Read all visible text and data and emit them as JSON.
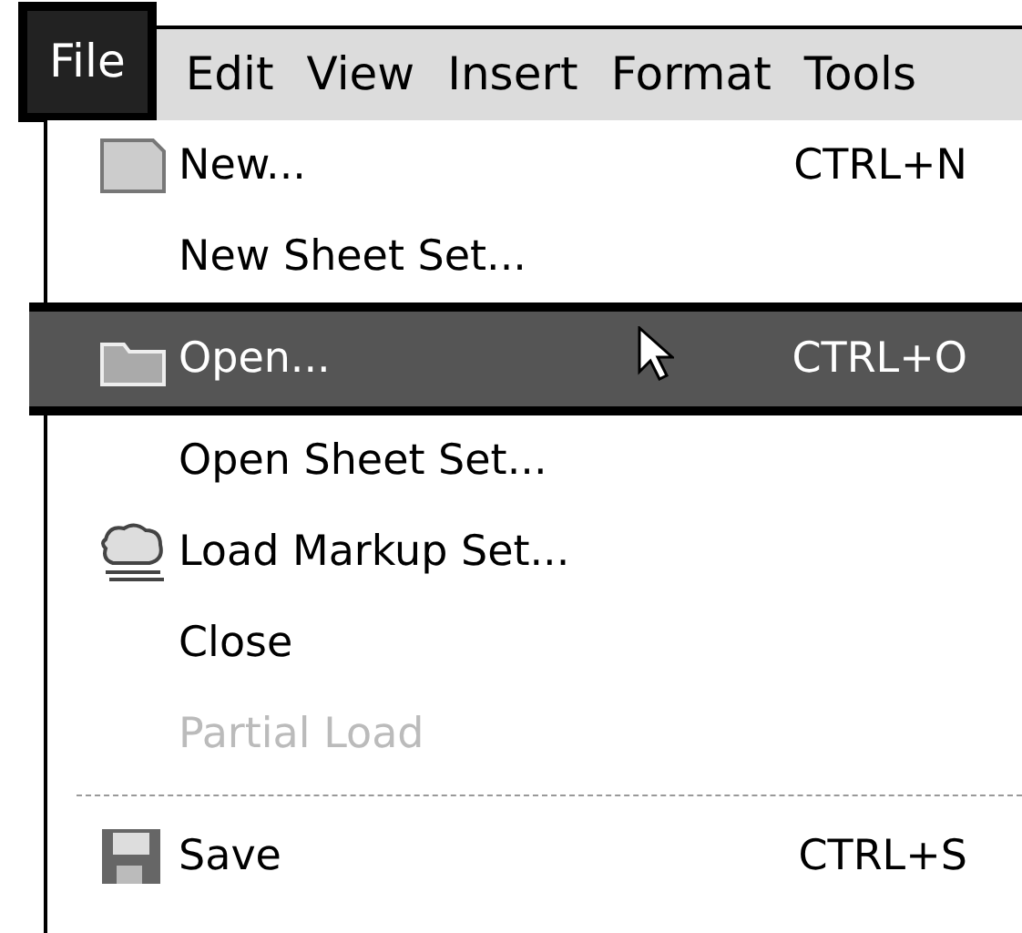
{
  "menu_bar": [
    {
      "label": "File",
      "selected": true
    },
    {
      "label": "Edit",
      "selected": false
    },
    {
      "label": "View",
      "selected": false
    },
    {
      "label": "Insert",
      "selected": false
    },
    {
      "label": "Format",
      "selected": false
    },
    {
      "label": "Tools",
      "selected": false
    }
  ],
  "file_menu": [
    {
      "kind": "item",
      "label": "New...",
      "shortcut": "CTRL+N",
      "selected": false,
      "disabled": false
    },
    {
      "kind": "item",
      "label": "New Sheet Set...",
      "selected": false,
      "disabled": false
    },
    {
      "kind": "item",
      "label": "Open...",
      "shortcut": "CTRL+O",
      "selected": true,
      "disabled": false
    },
    {
      "kind": "item",
      "label": "Open Sheet Set...",
      "selected": false,
      "disabled": false
    },
    {
      "kind": "item",
      "label": "Load Markup Set...",
      "selected": false,
      "disabled": false
    },
    {
      "kind": "item",
      "label": "Close",
      "selected": false,
      "disabled": false
    },
    {
      "kind": "item",
      "label": "Partial Load",
      "selected": false,
      "disabled": true
    },
    {
      "kind": "separator"
    },
    {
      "kind": "item",
      "label": "Save",
      "shortcut": "CTRL+S",
      "selected": false,
      "disabled": false
    }
  ]
}
